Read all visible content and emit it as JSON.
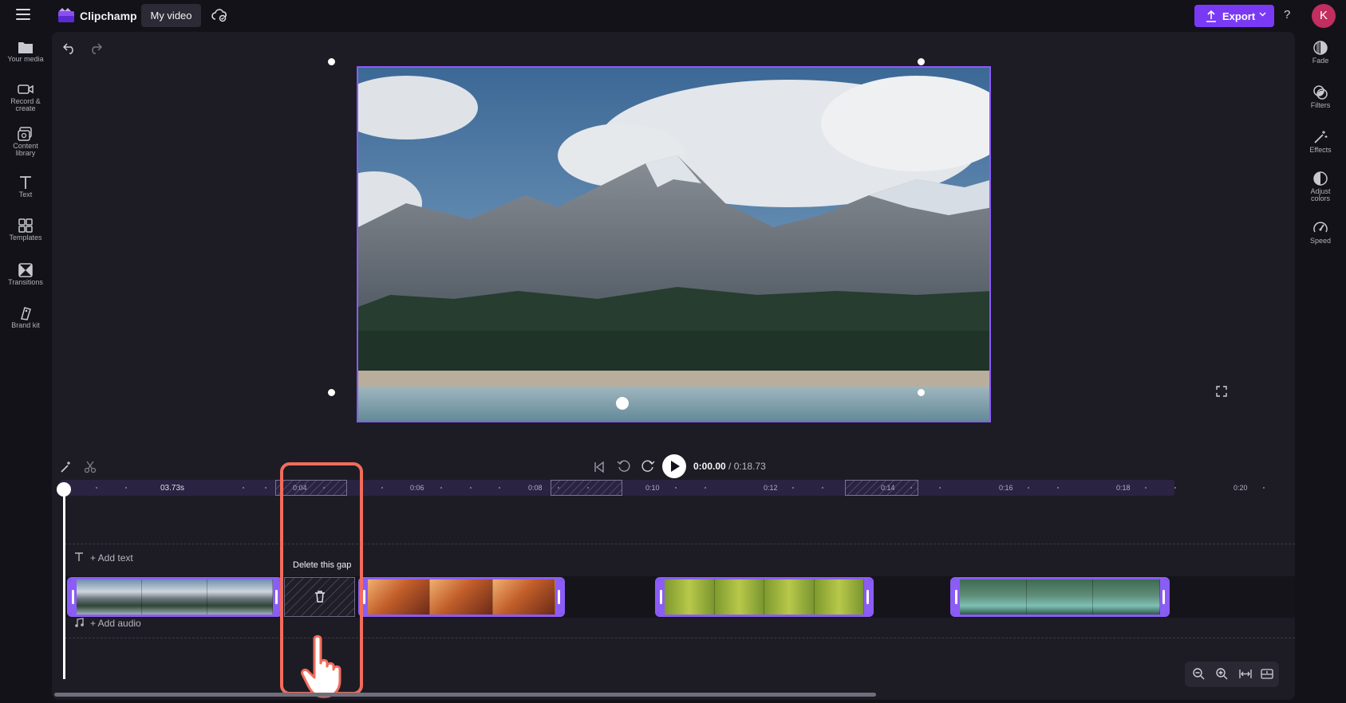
{
  "app": {
    "name": "Clipchamp",
    "project_title": "My video"
  },
  "header": {
    "export_label": "Export",
    "help_label": "?",
    "avatar_initial": "K"
  },
  "left_rail": [
    {
      "label": "Your media",
      "icon": "folder-icon"
    },
    {
      "label": "Record & create",
      "icon": "camera-icon"
    },
    {
      "label": "Content library",
      "icon": "content-library-icon"
    },
    {
      "label": "Text",
      "icon": "text-icon"
    },
    {
      "label": "Templates",
      "icon": "templates-icon"
    },
    {
      "label": "Transitions",
      "icon": "transitions-icon"
    },
    {
      "label": "Brand kit",
      "icon": "brand-kit-icon"
    }
  ],
  "right_rail": [
    {
      "label": "Fade",
      "icon": "fade-icon"
    },
    {
      "label": "Filters",
      "icon": "filters-icon"
    },
    {
      "label": "Effects",
      "icon": "effects-icon"
    },
    {
      "label": "Adjust colors",
      "icon": "adjust-colors-icon"
    },
    {
      "label": "Speed",
      "icon": "speed-icon"
    }
  ],
  "playback": {
    "current_time": "0:00.00",
    "separator": " / ",
    "total_time": "0:18.73"
  },
  "ruler": {
    "playhead_label": "03.73s",
    "ticks": [
      "0:04",
      "0:06",
      "0:08",
      "0:10",
      "0:12",
      "0:14",
      "0:16",
      "0:18",
      "0:20"
    ]
  },
  "tracks": {
    "add_text": "+ Add text",
    "add_audio": "+ Add audio"
  },
  "gap": {
    "tooltip": "Delete this gap"
  },
  "colors": {
    "accent": "#8b5cf6",
    "export": "#7a3af5",
    "highlight": "#f26c5c",
    "avatar": "#c12e5f"
  }
}
